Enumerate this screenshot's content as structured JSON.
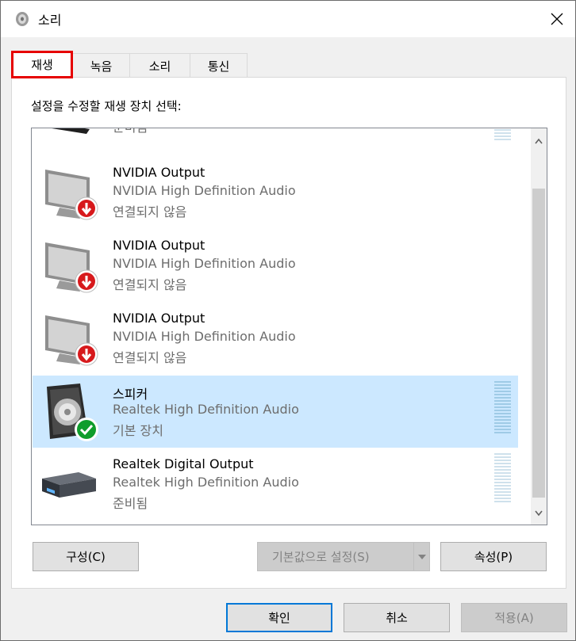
{
  "window": {
    "title": "소리"
  },
  "tabs": [
    {
      "label": "재생",
      "active": true
    },
    {
      "label": "녹음",
      "active": false
    },
    {
      "label": "소리",
      "active": false
    },
    {
      "label": "통신",
      "active": false
    }
  ],
  "playback": {
    "prompt": "설정을 수정할 재생 장치 선택:",
    "devices": [
      {
        "name": "",
        "driver": "",
        "status": "준비됨",
        "icon": "monitor-icon",
        "selected": false
      },
      {
        "name": "NVIDIA Output",
        "driver": "NVIDIA High Definition Audio",
        "status": "연결되지 않음",
        "icon": "monitor-icon",
        "badge": "disconnected-badge-icon",
        "selected": false
      },
      {
        "name": "NVIDIA Output",
        "driver": "NVIDIA High Definition Audio",
        "status": "연결되지 않음",
        "icon": "monitor-icon",
        "badge": "disconnected-badge-icon",
        "selected": false
      },
      {
        "name": "NVIDIA Output",
        "driver": "NVIDIA High Definition Audio",
        "status": "연결되지 않음",
        "icon": "monitor-icon",
        "badge": "disconnected-badge-icon",
        "selected": false
      },
      {
        "name": "스피커",
        "driver": "Realtek High Definition Audio",
        "status": "기본 장치",
        "icon": "speaker-icon",
        "badge": "default-check-icon",
        "selected": true
      },
      {
        "name": "Realtek Digital Output",
        "driver": "Realtek High Definition Audio",
        "status": "준비됨",
        "icon": "digital-output-icon",
        "selected": false
      }
    ],
    "buttons": {
      "configure": "구성(C)",
      "set_default": "기본값으로 설정(S)",
      "properties": "속성(P)"
    }
  },
  "footer": {
    "ok": "확인",
    "cancel": "취소",
    "apply": "적용(A)"
  },
  "colors": {
    "selection": "#cce8ff",
    "active_tab_highlight": "#e60000",
    "default_button_border": "#0078d7",
    "disconnected_badge": "#d7191c",
    "default_badge": "#0f9d2c"
  }
}
